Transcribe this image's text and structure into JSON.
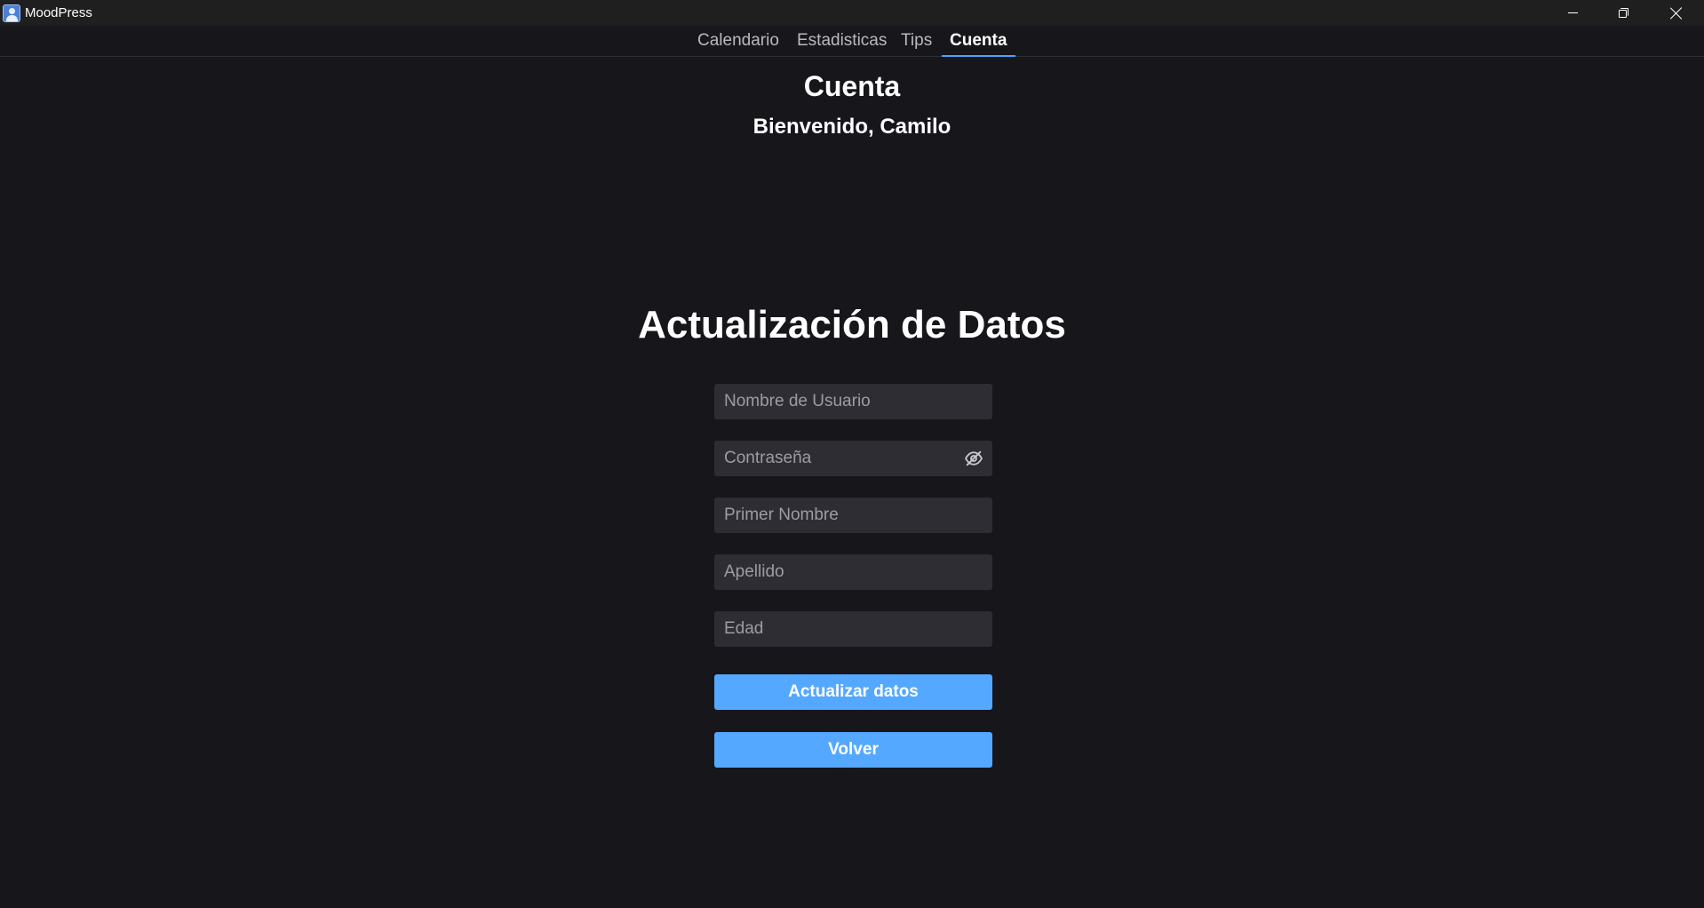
{
  "window": {
    "title": "MoodPress",
    "controls": [
      "minimize",
      "restore",
      "close"
    ]
  },
  "tabs": [
    {
      "label": "Calendario",
      "active": false
    },
    {
      "label": "Estadisticas",
      "active": false
    },
    {
      "label": "Tips",
      "active": false
    },
    {
      "label": "Cuenta",
      "active": true
    }
  ],
  "header": {
    "title": "Cuenta",
    "welcome": "Bienvenido, Camilo"
  },
  "form": {
    "title": "Actualización de Datos",
    "fields": {
      "username": {
        "value": "",
        "placeholder": "Nombre de Usuario"
      },
      "password": {
        "value": "",
        "placeholder": "Contraseña",
        "toggle_icon": "eye-off-icon"
      },
      "first_name": {
        "value": "",
        "placeholder": "Primer Nombre"
      },
      "last_name": {
        "value": "",
        "placeholder": "Apellido"
      },
      "age": {
        "value": "",
        "placeholder": "Edad"
      }
    },
    "update_button": "Actualizar datos",
    "back_button": "Volver"
  },
  "colors": {
    "background": "#16161b",
    "titlebar": "#1f1f1f",
    "field": "#2d2d33",
    "accent": "#55a8ff",
    "tab_indicator": "#4da3ff"
  }
}
